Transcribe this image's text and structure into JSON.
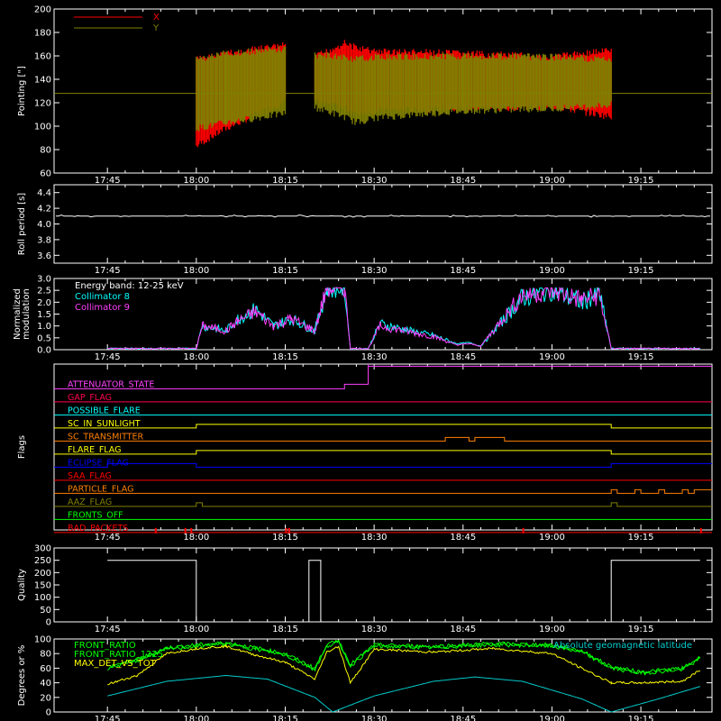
{
  "colors": {
    "background": "#000000",
    "axis": "#ffffff",
    "x_pointing": "#ff0000",
    "y_pointing": "#808000",
    "roll": "#ffffff",
    "coll8": "#00ffff",
    "coll9": "#ff40ff",
    "quality": "#ffffff",
    "front_ratio": "#00ff00",
    "front_ratio_1225": "#00ff00",
    "max_det": "#ffff00",
    "geomag": "#00cccc"
  },
  "time_ticks": [
    "17:45",
    "18:00",
    "18:15",
    "18:30",
    "18:45",
    "19:00",
    "19:15"
  ],
  "chart_data": [
    {
      "type": "line",
      "ylabel": "Pointing [\"]",
      "ylim": [
        60,
        200
      ],
      "yticks": [
        "60",
        "80",
        "100",
        "120",
        "140",
        "160",
        "180",
        "200"
      ],
      "legend": [
        "X",
        "Y"
      ],
      "series": [
        {
          "name": "X",
          "x": [
            "17:45",
            "18:00",
            "18:05",
            "18:15",
            "18:18",
            "18:20",
            "18:25",
            "18:27",
            "18:30",
            "18:45",
            "19:00",
            "19:10"
          ],
          "upper": [
            null,
            160,
            165,
            172,
            null,
            162,
            174,
            170,
            167,
            165,
            162,
            168
          ],
          "lower": [
            null,
            80,
            95,
            118,
            null,
            118,
            112,
            108,
            110,
            112,
            114,
            105
          ]
        },
        {
          "name": "Y",
          "x": [
            "17:45",
            "18:00",
            "18:05",
            "18:15",
            "18:18",
            "18:20",
            "18:25",
            "18:27",
            "18:30",
            "18:45",
            "19:00",
            "19:10"
          ],
          "upper": [
            128,
            160,
            165,
            169,
            null,
            164,
            162,
            160,
            162,
            163,
            162,
            160
          ],
          "lower": [
            128,
            95,
            100,
            108,
            null,
            113,
            105,
            100,
            104,
            110,
            112,
            115
          ]
        }
      ]
    },
    {
      "type": "line",
      "ylabel": "Roll period [s]",
      "ylim": [
        3.5,
        4.5
      ],
      "yticks": [
        "3.6",
        "3.8",
        "4.0",
        "4.2",
        "4.4"
      ],
      "series": [
        {
          "name": "",
          "x": [
            "17:45",
            "19:25"
          ],
          "values": [
            4.1,
            4.1
          ]
        }
      ]
    },
    {
      "type": "line",
      "ylabel": "Normalized modulation",
      "ylim": [
        0,
        3.0
      ],
      "yticks": [
        "0.0",
        "0.5",
        "1.0",
        "1.5",
        "2.0",
        "2.5",
        "3.0"
      ],
      "legend_title": "Energy band: 12-25 keV",
      "legend": [
        "Collimator 8",
        "Collimator 9"
      ],
      "series": [
        {
          "name": "Collimator 8",
          "x": [
            "17:45",
            "18:00",
            "18:01",
            "18:05",
            "18:07",
            "18:10",
            "18:13",
            "18:16",
            "18:20",
            "18:22",
            "18:25",
            "18:26",
            "18:29",
            "18:31",
            "18:35",
            "18:40",
            "18:44",
            "18:46",
            "18:48",
            "18:52",
            "18:55",
            "19:00",
            "19:05",
            "19:08",
            "19:10",
            "19:25"
          ],
          "values": [
            0.05,
            0.05,
            1.0,
            0.8,
            1.3,
            1.7,
            1.0,
            1.3,
            0.8,
            2.6,
            2.6,
            0.05,
            0.05,
            1.1,
            0.85,
            0.6,
            0.25,
            0.3,
            0.15,
            1.3,
            2.2,
            2.5,
            2.0,
            2.4,
            0.05,
            0.05
          ]
        },
        {
          "name": "Collimator 9",
          "x": [
            "17:45",
            "18:00",
            "18:01",
            "18:05",
            "18:07",
            "18:10",
            "18:13",
            "18:16",
            "18:20",
            "18:22",
            "18:25",
            "18:26",
            "18:29",
            "18:31",
            "18:35",
            "18:40",
            "18:44",
            "18:46",
            "18:48",
            "18:52",
            "18:55",
            "19:00",
            "19:05",
            "19:08",
            "19:10",
            "19:25"
          ],
          "values": [
            0.05,
            0.05,
            1.0,
            0.8,
            1.2,
            1.6,
            1.0,
            1.3,
            0.8,
            2.6,
            2.6,
            0.05,
            0.05,
            1.0,
            0.8,
            0.55,
            0.2,
            0.25,
            0.15,
            1.4,
            2.3,
            2.5,
            2.1,
            2.3,
            0.05,
            0.05
          ]
        }
      ]
    },
    {
      "type": "flags",
      "ylabel": "Flags",
      "flags": [
        {
          "name": "ATTENUATOR_STATE",
          "color": "#ff40ff",
          "segments": [
            [
              "18:25",
              "18:29",
              1
            ],
            [
              "18:29",
              "19:25",
              2
            ]
          ]
        },
        {
          "name": "GAP_FLAG",
          "color": "#ff0050",
          "segments": []
        },
        {
          "name": "POSSIBLE_FLARE",
          "color": "#00ffff",
          "segments": []
        },
        {
          "name": "SC_IN_SUNLIGHT",
          "color": "#ffff00",
          "segments": [
            [
              "18:00",
              "19:10",
              1
            ]
          ]
        },
        {
          "name": "SC_TRANSMITTER",
          "color": "#ff8000",
          "segments": [
            [
              "18:42",
              "18:46",
              1
            ],
            [
              "18:47",
              "18:52",
              1
            ]
          ]
        },
        {
          "name": "FLARE_FLAG",
          "color": "#ffff00",
          "segments": [
            [
              "18:00",
              "19:10",
              1
            ]
          ]
        },
        {
          "name": "ECLIPSE_FLAG",
          "color": "#0000ff",
          "segments": [
            [
              "17:45",
              "18:00",
              1
            ],
            [
              "19:10",
              "19:25",
              1
            ]
          ]
        },
        {
          "name": "SAA_FLAG",
          "color": "#ff0000",
          "segments": []
        },
        {
          "name": "PARTICLE_FLAG",
          "color": "#ff8000",
          "segments": [
            [
              "19:10",
              "19:11",
              1
            ],
            [
              "19:14",
              "19:15",
              1
            ],
            [
              "19:18",
              "19:19",
              1
            ],
            [
              "19:22",
              "19:23",
              1
            ],
            [
              "19:24",
              "19:25",
              1
            ]
          ]
        },
        {
          "name": "AAZ_FLAG",
          "color": "#808000",
          "segments": [
            [
              "18:00",
              "18:01",
              1
            ],
            [
              "19:10",
              "19:11",
              1
            ]
          ]
        },
        {
          "name": "FRONTS_OFF",
          "color": "#00ff00",
          "segments": []
        },
        {
          "name": "BAD_PACKETS",
          "color": "#ff0000",
          "segments": [
            [
              "17:53",
              "17:53.3",
              1
            ],
            [
              "17:58",
              "17:58.3",
              1
            ],
            [
              "17:59",
              "17:59.3",
              1
            ],
            [
              "18:15",
              "18:15.3",
              1
            ],
            [
              "18:15.5",
              "18:15.8",
              1
            ],
            [
              "18:55",
              "18:55.3",
              1
            ],
            [
              "19:25",
              "19:25.3",
              1
            ]
          ]
        }
      ]
    },
    {
      "type": "line",
      "ylabel": "Quality",
      "ylim": [
        0,
        300
      ],
      "yticks": [
        "0",
        "50",
        "100",
        "150",
        "200",
        "250",
        "300"
      ],
      "series": [
        {
          "name": "",
          "x": [
            "17:45",
            "18:00",
            "18:00",
            "18:19",
            "18:19",
            "18:21",
            "18:21",
            "19:10",
            "19:10",
            "19:25"
          ],
          "values": [
            250,
            250,
            0,
            0,
            250,
            250,
            0,
            0,
            250,
            250
          ]
        }
      ]
    },
    {
      "type": "line",
      "ylabel": "Degrees or %",
      "ylim": [
        0,
        100
      ],
      "yticks": [
        "0",
        "20",
        "40",
        "60",
        "80",
        "100"
      ],
      "legend": [
        "FRONT_RATIO",
        "FRONT_RATIO_1225",
        "MAX_DET_VS_TOT",
        "Absolute geomagnetic latitude"
      ],
      "series": [
        {
          "name": "FRONT_RATIO",
          "x": [
            "17:45",
            "17:50",
            "17:55",
            "18:00",
            "18:05",
            "18:10",
            "18:15",
            "18:20",
            "18:22",
            "18:24",
            "18:26",
            "18:30",
            "18:40",
            "18:50",
            "19:00",
            "19:05",
            "19:10",
            "19:15",
            "19:22",
            "19:25"
          ],
          "values": [
            62,
            72,
            88,
            92,
            95,
            88,
            80,
            60,
            92,
            98,
            65,
            92,
            90,
            94,
            92,
            84,
            62,
            55,
            60,
            75
          ]
        },
        {
          "name": "FRONT_RATIO_1225",
          "x": [
            "17:45",
            "17:50",
            "17:55",
            "18:00",
            "18:05",
            "18:10",
            "18:15",
            "18:20",
            "18:22",
            "18:24",
            "18:26",
            "18:30",
            "18:40",
            "18:50",
            "19:00",
            "19:05",
            "19:10",
            "19:15",
            "19:22",
            "19:25"
          ],
          "values": [
            60,
            70,
            86,
            90,
            93,
            86,
            78,
            58,
            90,
            96,
            63,
            90,
            88,
            92,
            90,
            82,
            60,
            53,
            58,
            73
          ]
        },
        {
          "name": "MAX_DET_VS_TOT",
          "x": [
            "17:45",
            "17:50",
            "17:55",
            "18:00",
            "18:05",
            "18:10",
            "18:15",
            "18:20",
            "18:22",
            "18:24",
            "18:26",
            "18:30",
            "18:40",
            "18:50",
            "19:00",
            "19:05",
            "19:10",
            "19:15",
            "19:22",
            "19:25"
          ],
          "values": [
            38,
            50,
            80,
            87,
            90,
            78,
            68,
            45,
            82,
            90,
            40,
            86,
            82,
            87,
            80,
            60,
            40,
            40,
            42,
            58
          ]
        },
        {
          "name": "Absolute geomagnetic latitude",
          "x": [
            "17:45",
            "17:55",
            "18:05",
            "18:12",
            "18:20",
            "18:23",
            "18:30",
            "18:40",
            "18:47",
            "18:55",
            "19:05",
            "19:10",
            "19:18",
            "19:25"
          ],
          "values": [
            22,
            42,
            50,
            45,
            20,
            0,
            22,
            42,
            48,
            42,
            18,
            0,
            18,
            35
          ]
        }
      ]
    }
  ]
}
